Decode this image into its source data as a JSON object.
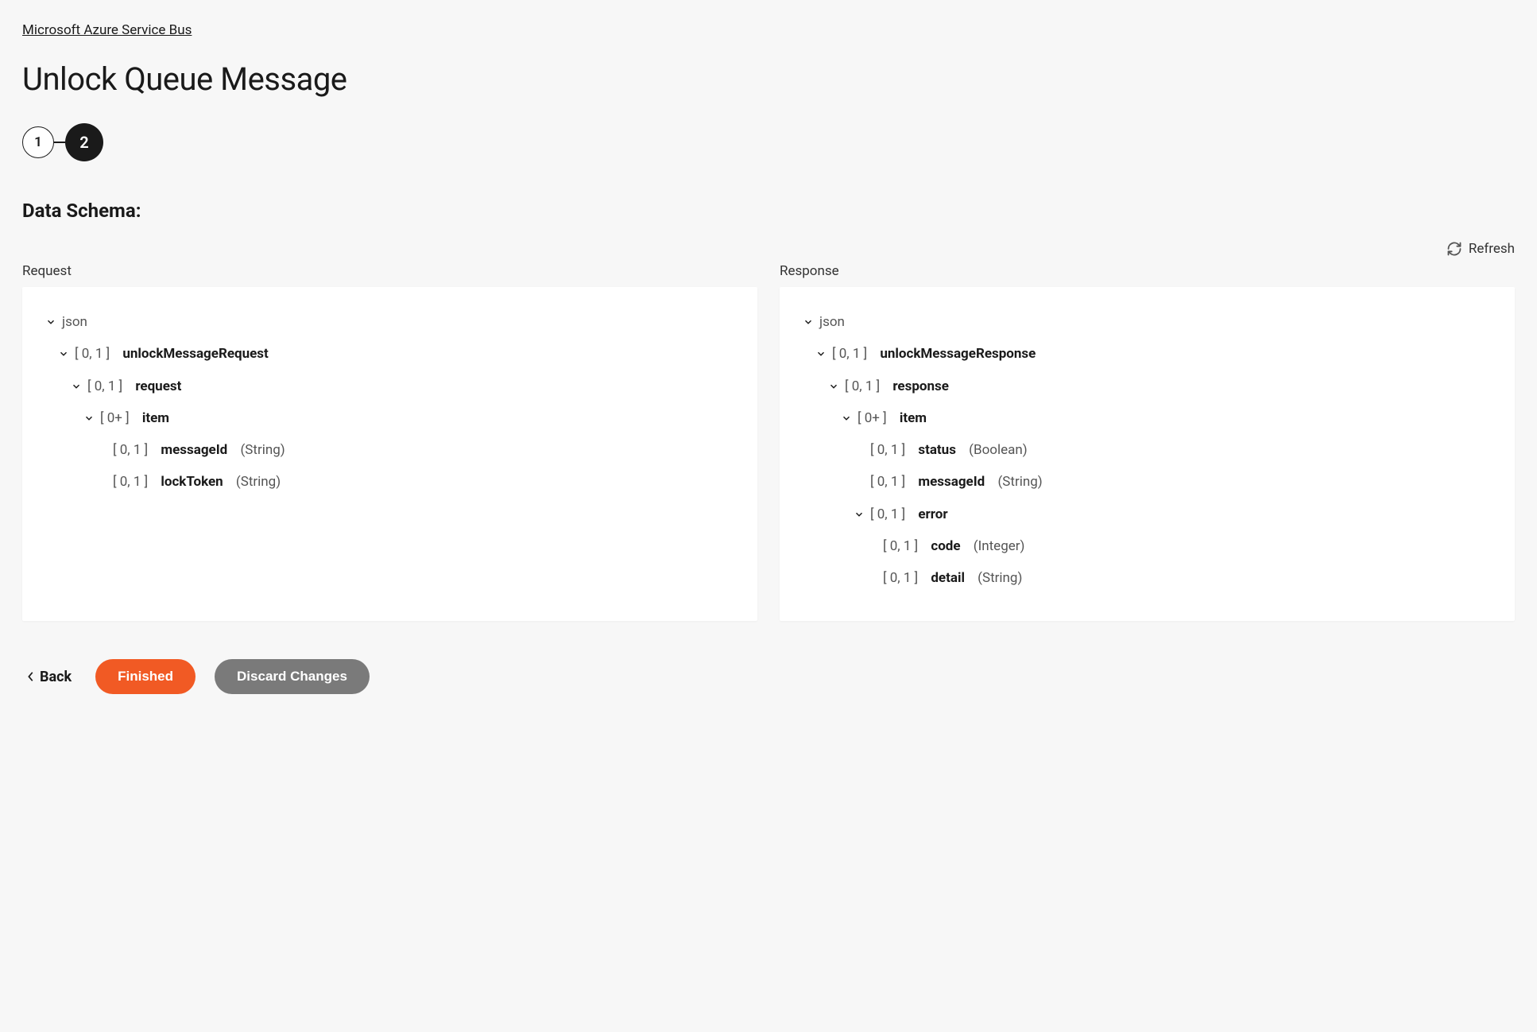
{
  "breadcrumb": "Microsoft Azure Service Bus",
  "page_title": "Unlock Queue Message",
  "stepper": {
    "step1": "1",
    "step2": "2"
  },
  "section_title": "Data Schema:",
  "refresh_label": "Refresh",
  "columns": {
    "request": "Request",
    "response": "Response"
  },
  "cardinality": {
    "zero_one": "[ 0, 1 ]",
    "zero_plus": "[ 0+ ]"
  },
  "types": {
    "string": "(String)",
    "boolean": "(Boolean)",
    "integer": "(Integer)"
  },
  "request_tree": {
    "root": "json",
    "n1": "unlockMessageRequest",
    "n2": "request",
    "n3": "item",
    "n4": "messageId",
    "n5": "lockToken"
  },
  "response_tree": {
    "root": "json",
    "n1": "unlockMessageResponse",
    "n2": "response",
    "n3": "item",
    "n4": "status",
    "n5": "messageId",
    "n6": "error",
    "n7": "code",
    "n8": "detail"
  },
  "footer": {
    "back": "Back",
    "finished": "Finished",
    "discard": "Discard Changes"
  }
}
